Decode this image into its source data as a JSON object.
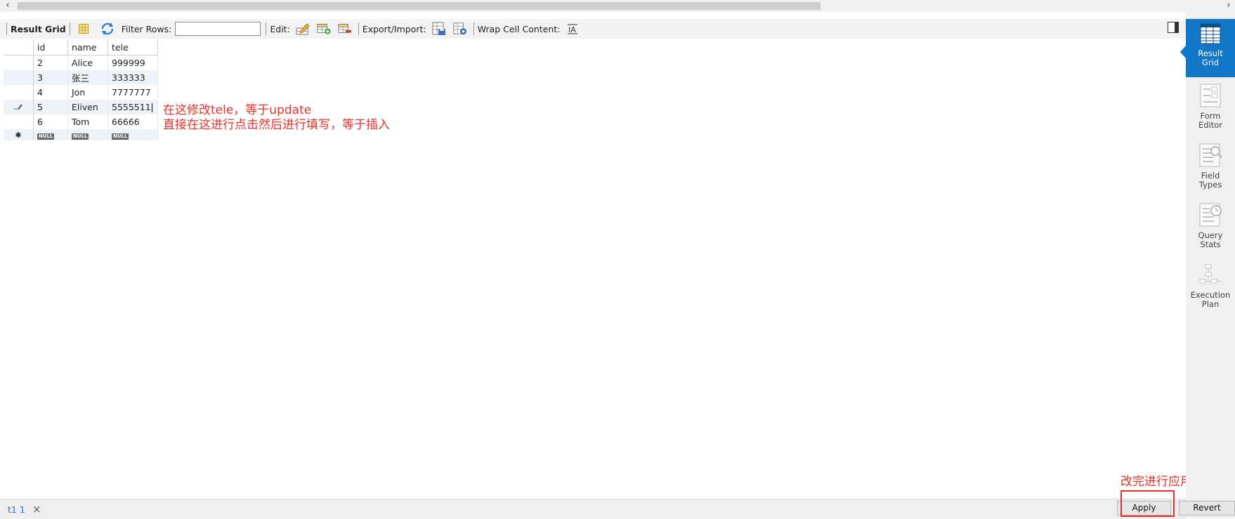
{
  "toolbar": {
    "result_grid_label": "Result Grid",
    "filter_rows_label": "Filter Rows:",
    "filter_rows_value": "",
    "edit_label": "Edit:",
    "export_import_label": "Export/Import:",
    "wrap_cell_label": "Wrap Cell Content:"
  },
  "grid": {
    "columns": [
      "id",
      "name",
      "tele"
    ],
    "rows": [
      {
        "id": "2",
        "name": "Alice",
        "tele": "999999"
      },
      {
        "id": "3",
        "name": "张三",
        "tele": "333333"
      },
      {
        "id": "4",
        "name": "Jon",
        "tele": "7777777"
      },
      {
        "id": "5",
        "name": "Eliven",
        "tele": "5555511"
      },
      {
        "id": "6",
        "name": "Tom",
        "tele": "66666"
      }
    ],
    "null_label": "NULL"
  },
  "annotations": {
    "line1": "在这修改tele，等于update",
    "line2": "直接在这进行点击然后进行填写，等于插入",
    "apply_note": "改完进行应用"
  },
  "side_panel": [
    {
      "label_line1": "Result",
      "label_line2": "Grid",
      "icon": "result-grid-icon"
    },
    {
      "label_line1": "Form",
      "label_line2": "Editor",
      "icon": "form-editor-icon"
    },
    {
      "label_line1": "Field",
      "label_line2": "Types",
      "icon": "field-types-icon"
    },
    {
      "label_line1": "Query",
      "label_line2": "Stats",
      "icon": "query-stats-icon"
    },
    {
      "label_line1": "Execution",
      "label_line2": "Plan",
      "icon": "execution-plan-icon"
    }
  ],
  "bottom": {
    "tab_label": "t1 1",
    "apply_label": "Apply",
    "revert_label": "Revert"
  },
  "colors": {
    "accent": "#1277c7",
    "annotation": "#e8302a",
    "alt_row": "#eef3fa"
  }
}
